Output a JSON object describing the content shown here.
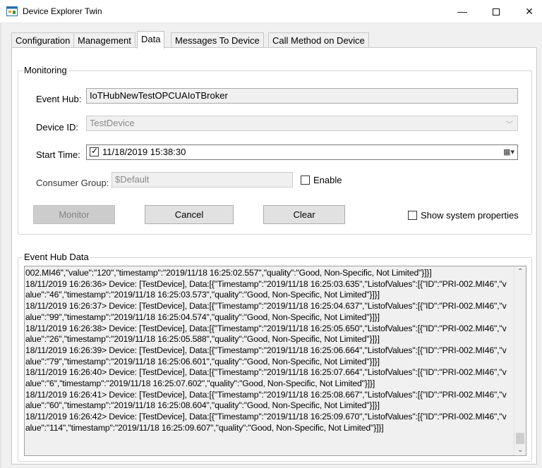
{
  "window": {
    "title": "Device Explorer Twin",
    "minimize_glyph": "—",
    "close_glyph": "✕"
  },
  "tabs": [
    {
      "label": "Configuration"
    },
    {
      "label": "Management"
    },
    {
      "label": "Data"
    },
    {
      "label": "Messages To Device"
    },
    {
      "label": "Call Method on Device"
    }
  ],
  "active_tab": "Data",
  "monitoring": {
    "title": "Monitoring",
    "event_hub_label": "Event Hub:",
    "event_hub_value": "IoTHubNewTestOPCUAIoTBroker",
    "device_id_label": "Device ID:",
    "device_id_value": "TestDevice",
    "start_time_label": "Start Time:",
    "start_time_value": "11/18/2019 15:38:30",
    "start_time_checked": true,
    "consumer_group_label": "Consumer Group:",
    "consumer_group_value": "$Default",
    "enable_label": "Enable",
    "enable_checked": false,
    "monitor_button": "Monitor",
    "cancel_button": "Cancel",
    "clear_button": "Clear",
    "show_system_properties_label": "Show system properties",
    "show_system_properties_checked": false
  },
  "event_hub_data": {
    "title": "Event Hub Data",
    "log_text": "002.MI46\",\"value\":\"120\",\"timestamp\":\"2019/11/18 16:25:02.557\",\"quality\":\"Good, Non-Specific, Not Limited\"}]}]\n18/11/2019 16:26:36> Device: [TestDevice], Data:[{\"Timestamp\":\"2019/11/18 16:25:03.635\",\"ListofValues\":[{\"ID\":\"PRI-002.MI46\",\"value\":\"46\",\"timestamp\":\"2019/11/18 16:25:03.573\",\"quality\":\"Good, Non-Specific, Not Limited\"}]}]\n18/11/2019 16:26:37> Device: [TestDevice], Data:[{\"Timestamp\":\"2019/11/18 16:25:04.637\",\"ListofValues\":[{\"ID\":\"PRI-002.MI46\",\"value\":\"99\",\"timestamp\":\"2019/11/18 16:25:04.574\",\"quality\":\"Good, Non-Specific, Not Limited\"}]}]\n18/11/2019 16:26:38> Device: [TestDevice], Data:[{\"Timestamp\":\"2019/11/18 16:25:05.650\",\"ListofValues\":[{\"ID\":\"PRI-002.MI46\",\"value\":\"26\",\"timestamp\":\"2019/11/18 16:25:05.588\",\"quality\":\"Good, Non-Specific, Not Limited\"}]}]\n18/11/2019 16:26:39> Device: [TestDevice], Data:[{\"Timestamp\":\"2019/11/18 16:25:06.664\",\"ListofValues\":[{\"ID\":\"PRI-002.MI46\",\"value\":\"79\",\"timestamp\":\"2019/11/18 16:25:06.601\",\"quality\":\"Good, Non-Specific, Not Limited\"}]}]\n18/11/2019 16:26:40> Device: [TestDevice], Data:[{\"Timestamp\":\"2019/11/18 16:25:07.664\",\"ListofValues\":[{\"ID\":\"PRI-002.MI46\",\"value\":\"6\",\"timestamp\":\"2019/11/18 16:25:07.602\",\"quality\":\"Good, Non-Specific, Not Limited\"}]}]\n18/11/2019 16:26:41> Device: [TestDevice], Data:[{\"Timestamp\":\"2019/11/18 16:25:08.667\",\"ListofValues\":[{\"ID\":\"PRI-002.MI46\",\"value\":\"60\",\"timestamp\":\"2019/11/18 16:25:08.604\",\"quality\":\"Good, Non-Specific, Not Limited\"}]}]\n18/11/2019 16:26:42> Device: [TestDevice], Data:[{\"Timestamp\":\"2019/11/18 16:25:09.670\",\"ListofValues\":[{\"ID\":\"PRI-002.MI46\",\"value\":\"114\",\"timestamp\":\"2019/11/18 16:25:09.607\",\"quality\":\"Good, Non-Specific, Not Limited\"}]}]"
  },
  "icons": {
    "app": "app-window-icon",
    "dropdown": "chevron-down-icon",
    "calendar": "calendar-dropdown-icon"
  }
}
